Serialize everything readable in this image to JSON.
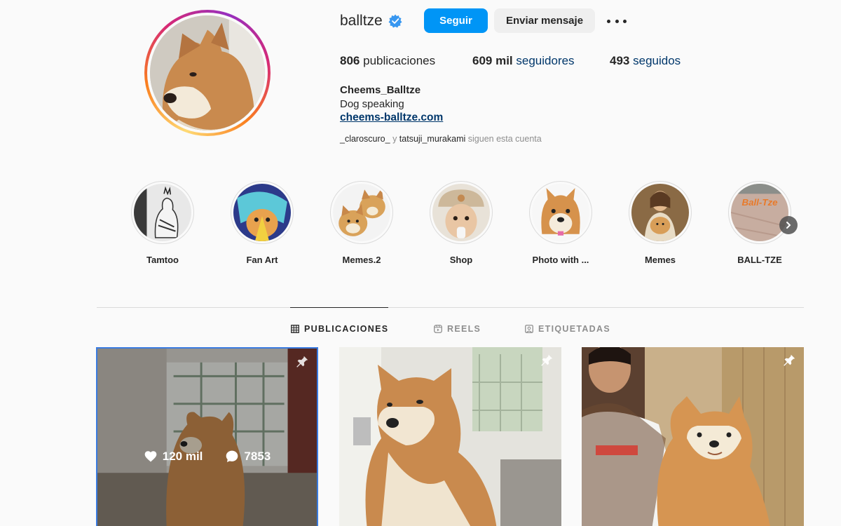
{
  "profile": {
    "username": "balltze",
    "verified": true,
    "follow_label": "Seguir",
    "message_label": "Enviar mensaje",
    "more_icon": "more-horizontal-icon",
    "stats": {
      "posts_count": "806",
      "posts_label": "publicaciones",
      "followers_count": "609 mil",
      "followers_label": "seguidores",
      "following_count": "493",
      "following_label": "seguidos"
    },
    "full_name": "Cheems_Balltze",
    "bio": "Dog speaking",
    "website": "cheems-balltze.com",
    "followed_by": {
      "user1": "_claroscuro_",
      "joiner": "y",
      "user2": "tatsuji_murakami",
      "suffix": "siguen esta cuenta"
    }
  },
  "highlights": [
    {
      "label": "Tamtoo"
    },
    {
      "label": "Fan Art"
    },
    {
      "label": "Memes.2"
    },
    {
      "label": "Shop"
    },
    {
      "label": "Photo with ..."
    },
    {
      "label": "Memes"
    },
    {
      "label": "BALL-TZE",
      "image_text": "Ball-Tze"
    }
  ],
  "tabs": [
    {
      "label": "PUBLICACIONES",
      "icon": "grid-icon",
      "active": true
    },
    {
      "label": "REELS",
      "icon": "reels-icon",
      "active": false
    },
    {
      "label": "ETIQUETADAS",
      "icon": "tagged-icon",
      "active": false
    }
  ],
  "posts": [
    {
      "likes": "120 mil",
      "comments": "7853",
      "pinned": true,
      "hovered": true
    },
    {
      "pinned": true,
      "hovered": false
    },
    {
      "pinned": true,
      "hovered": false
    }
  ],
  "colors": {
    "accent": "#0095f6",
    "link": "#00376b",
    "text": "#262626",
    "muted": "#8e8e8e",
    "background": "#fafafa"
  }
}
